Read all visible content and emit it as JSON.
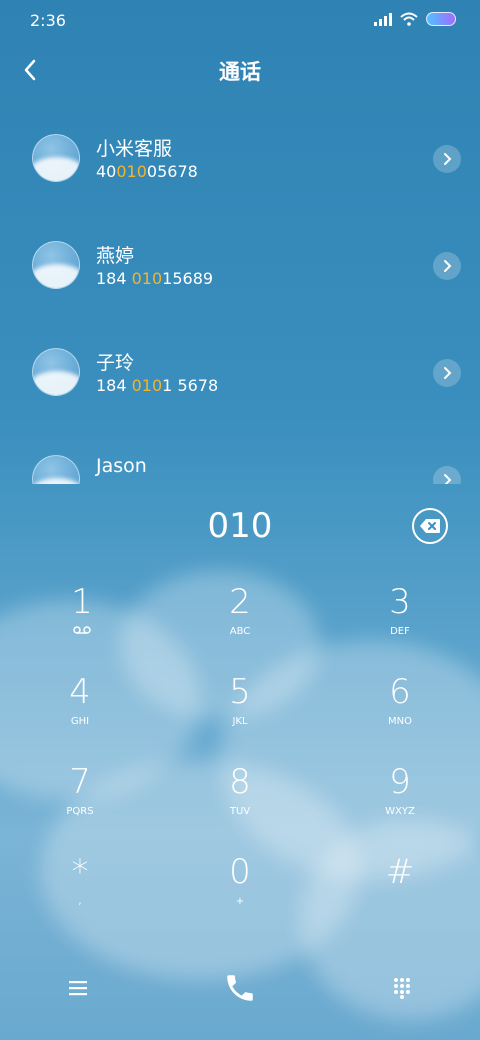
{
  "status": {
    "time": "2:36"
  },
  "header": {
    "title": "通话",
    "back_icon": "back-arrow-icon"
  },
  "contacts": [
    {
      "name": "小米客服",
      "num_pre": "40",
      "num_hl": "010",
      "num_post": "05678"
    },
    {
      "name": "燕婷",
      "num_pre": "184 ",
      "num_hl": "010",
      "num_post": "15689"
    },
    {
      "name": "子玲",
      "num_pre": "184 ",
      "num_hl": "010",
      "num_post": "1 5678"
    },
    {
      "name": "Jason",
      "num_pre": "",
      "num_hl": "",
      "num_post": ""
    }
  ],
  "dialer": {
    "input": "010"
  },
  "keys": [
    {
      "digit": "1",
      "letters": ""
    },
    {
      "digit": "2",
      "letters": "ABC"
    },
    {
      "digit": "3",
      "letters": "DEF"
    },
    {
      "digit": "4",
      "letters": "GHI"
    },
    {
      "digit": "5",
      "letters": "JKL"
    },
    {
      "digit": "6",
      "letters": "MNO"
    },
    {
      "digit": "7",
      "letters": "PQRS"
    },
    {
      "digit": "8",
      "letters": "TUV"
    },
    {
      "digit": "9",
      "letters": "WXYZ"
    },
    {
      "digit": "*",
      "letters": ","
    },
    {
      "digit": "0",
      "letters": "+"
    },
    {
      "digit": "#",
      "letters": ""
    }
  ],
  "colors": {
    "highlight": "#f2b52a",
    "background": "#3a8fbe"
  }
}
